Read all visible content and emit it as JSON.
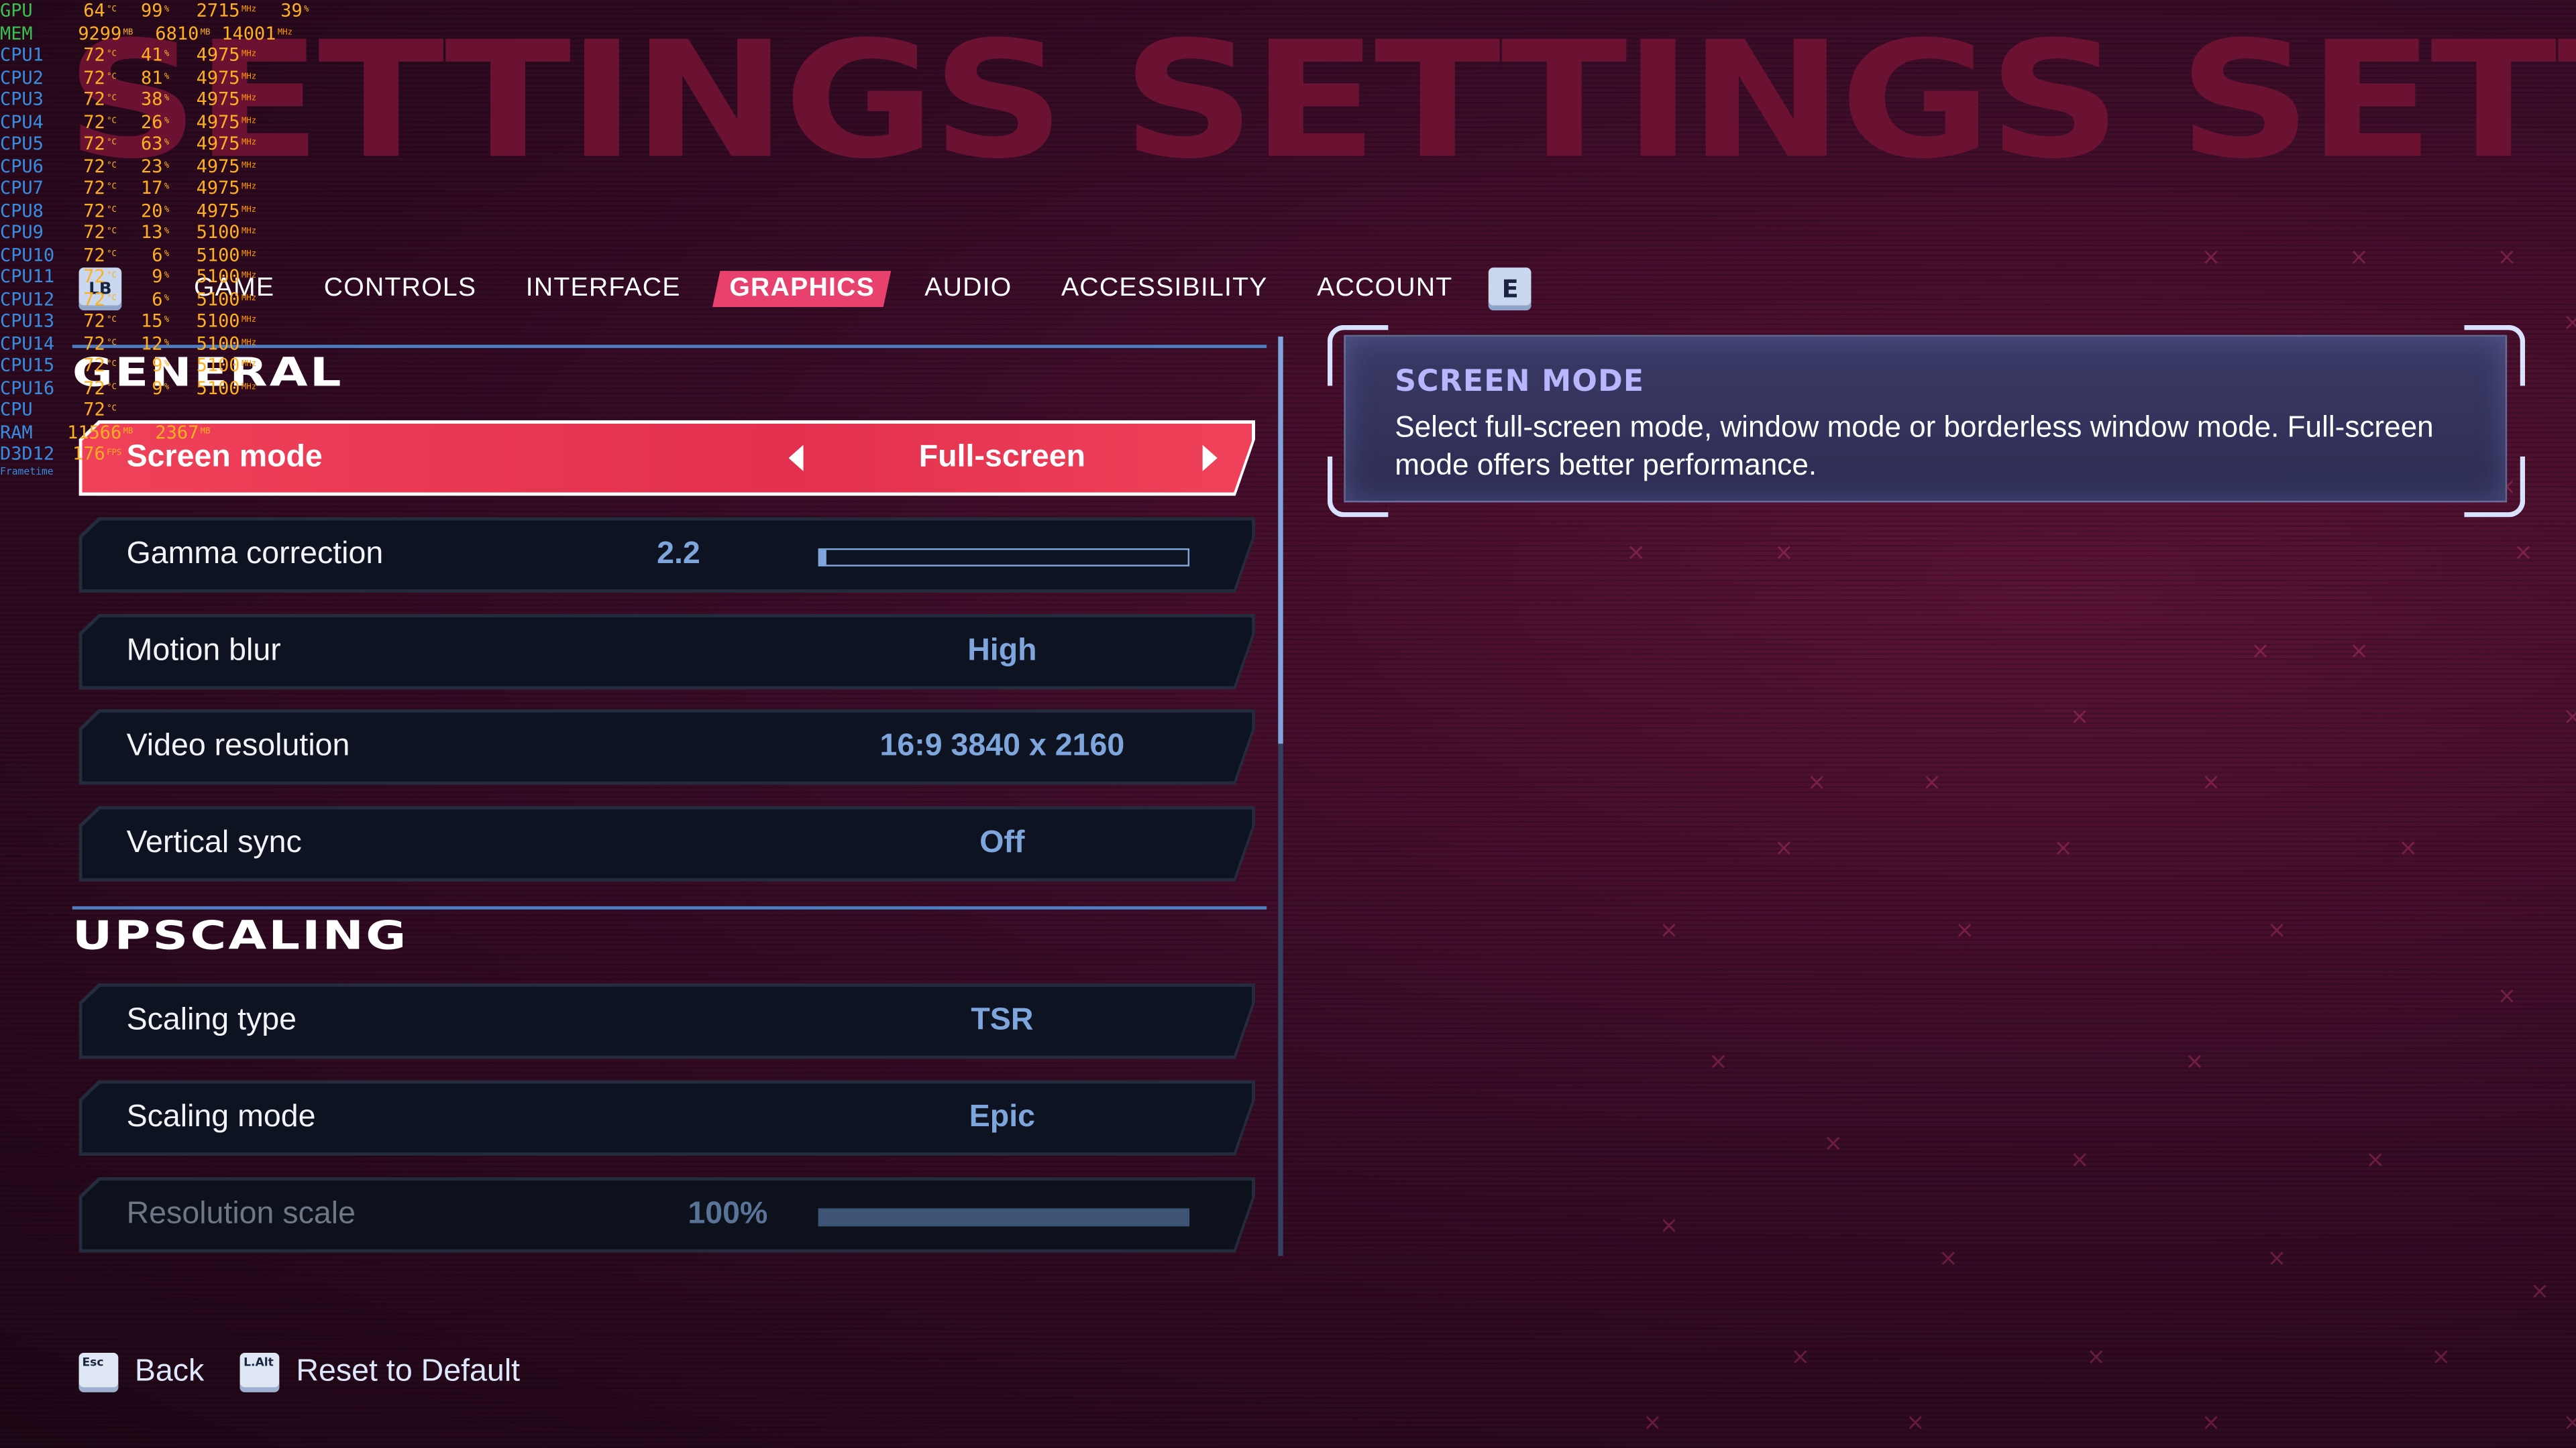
{
  "header": {
    "big_title": "SETTINGS SETTINGS SETTIN"
  },
  "tabs": {
    "left_key": "LB",
    "right_key": "E",
    "items": [
      {
        "label": "GAME",
        "active": false
      },
      {
        "label": "CONTROLS",
        "active": false
      },
      {
        "label": "INTERFACE",
        "active": false
      },
      {
        "label": "GRAPHICS",
        "active": true
      },
      {
        "label": "AUDIO",
        "active": false
      },
      {
        "label": "ACCESSIBILITY",
        "active": false
      },
      {
        "label": "ACCOUNT",
        "active": false
      }
    ]
  },
  "sections": {
    "general": "GENERAL",
    "upscaling": "UPSCALING"
  },
  "settings": {
    "screen_mode": {
      "label": "Screen mode",
      "value": "Full-screen"
    },
    "gamma": {
      "label": "Gamma correction",
      "value": "2.2",
      "fraction": 0.02
    },
    "motion_blur": {
      "label": "Motion blur",
      "value": "High"
    },
    "video_resolution": {
      "label": "Video resolution",
      "value": "16:9 3840 x 2160"
    },
    "vsync": {
      "label": "Vertical sync",
      "value": "Off"
    },
    "scaling_type": {
      "label": "Scaling type",
      "value": "TSR"
    },
    "scaling_mode": {
      "label": "Scaling mode",
      "value": "Epic"
    },
    "resolution_scale": {
      "label": "Resolution scale",
      "value": "100%",
      "fraction": 1.0
    }
  },
  "description": {
    "title": "SCREEN MODE",
    "text": "Select full-screen mode, window mode or borderless window mode. Full-screen mode offers better performance."
  },
  "footer": {
    "back_key": "Esc",
    "back_label": "Back",
    "reset_key": "L.Alt",
    "reset_label": "Reset to Default"
  },
  "overlay": {
    "gpu": {
      "name": "GPU",
      "temp": "64",
      "load": "99",
      "clock": "2715",
      "fan": "39"
    },
    "mem": {
      "name": "MEM",
      "v1": "9299",
      "v2": "6810",
      "v3": "14001"
    },
    "cpus": [
      {
        "name": "CPU1",
        "temp": "72",
        "load": "41",
        "clock": "4975"
      },
      {
        "name": "CPU2",
        "temp": "72",
        "load": "81",
        "clock": "4975"
      },
      {
        "name": "CPU3",
        "temp": "72",
        "load": "38",
        "clock": "4975"
      },
      {
        "name": "CPU4",
        "temp": "72",
        "load": "26",
        "clock": "4975"
      },
      {
        "name": "CPU5",
        "temp": "72",
        "load": "63",
        "clock": "4975"
      },
      {
        "name": "CPU6",
        "temp": "72",
        "load": "23",
        "clock": "4975"
      },
      {
        "name": "CPU7",
        "temp": "72",
        "load": "17",
        "clock": "4975"
      },
      {
        "name": "CPU8",
        "temp": "72",
        "load": "20",
        "clock": "4975"
      },
      {
        "name": "CPU9",
        "temp": "72",
        "load": "13",
        "clock": "5100"
      },
      {
        "name": "CPU10",
        "temp": "72",
        "load": "6",
        "clock": "5100"
      },
      {
        "name": "CPU11",
        "temp": "72",
        "load": "9",
        "clock": "5100"
      },
      {
        "name": "CPU12",
        "temp": "72",
        "load": "6",
        "clock": "5100"
      },
      {
        "name": "CPU13",
        "temp": "72",
        "load": "15",
        "clock": "5100"
      },
      {
        "name": "CPU14",
        "temp": "72",
        "load": "12",
        "clock": "5100"
      },
      {
        "name": "CPU15",
        "temp": "72",
        "load": "9",
        "clock": "5100"
      },
      {
        "name": "CPU16",
        "temp": "72",
        "load": "9",
        "clock": "5100"
      }
    ],
    "cpu_total": {
      "name": "CPU",
      "temp": "72"
    },
    "ram": {
      "name": "RAM",
      "v1": "11566",
      "v2": "2367"
    },
    "d3d": {
      "name": "D3D12",
      "fps": "176",
      "frametime_label": "Frametime"
    }
  },
  "colors": {
    "accent": "#e8416e",
    "value_blue": "#7ea6dc",
    "panel_purple": "#34345e"
  }
}
